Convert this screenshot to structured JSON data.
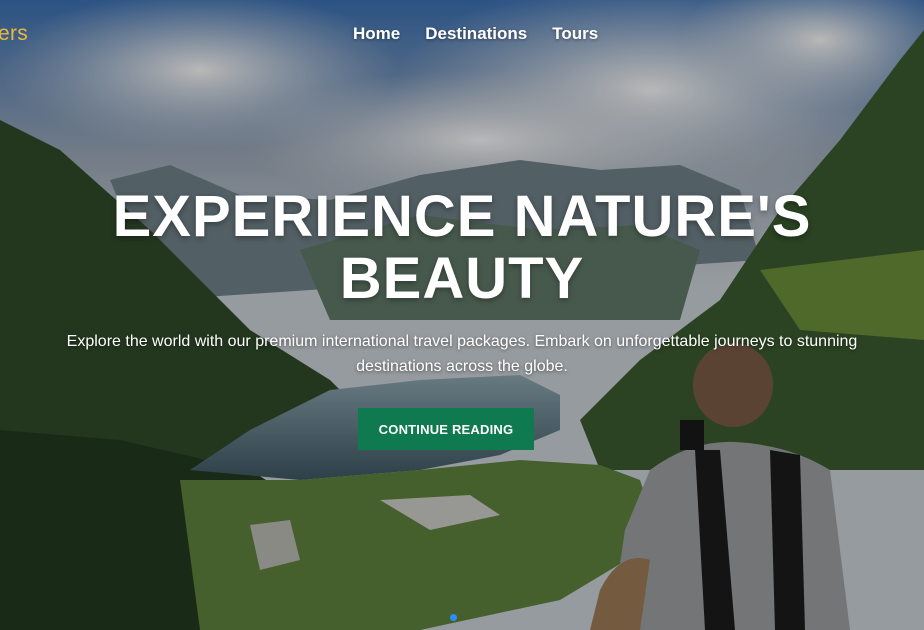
{
  "brand": {
    "text": "ers"
  },
  "nav": {
    "items": [
      {
        "label": "Home"
      },
      {
        "label": "Destinations"
      },
      {
        "label": "Tours"
      }
    ]
  },
  "hero": {
    "headline_line1": "EXPERIENCE NATURE'S",
    "headline_line2": "BEAUTY",
    "subtitle": "Explore the world with our premium international travel packages. Embark on unforgettable journeys to stunning destinations across the globe.",
    "cta_label": "CONTINUE READING"
  },
  "carousel": {
    "active_index": 0,
    "count": 1
  },
  "colors": {
    "brand": "#e8b93a",
    "cta": "#0f7a4f",
    "dot": "#2f8cff"
  }
}
